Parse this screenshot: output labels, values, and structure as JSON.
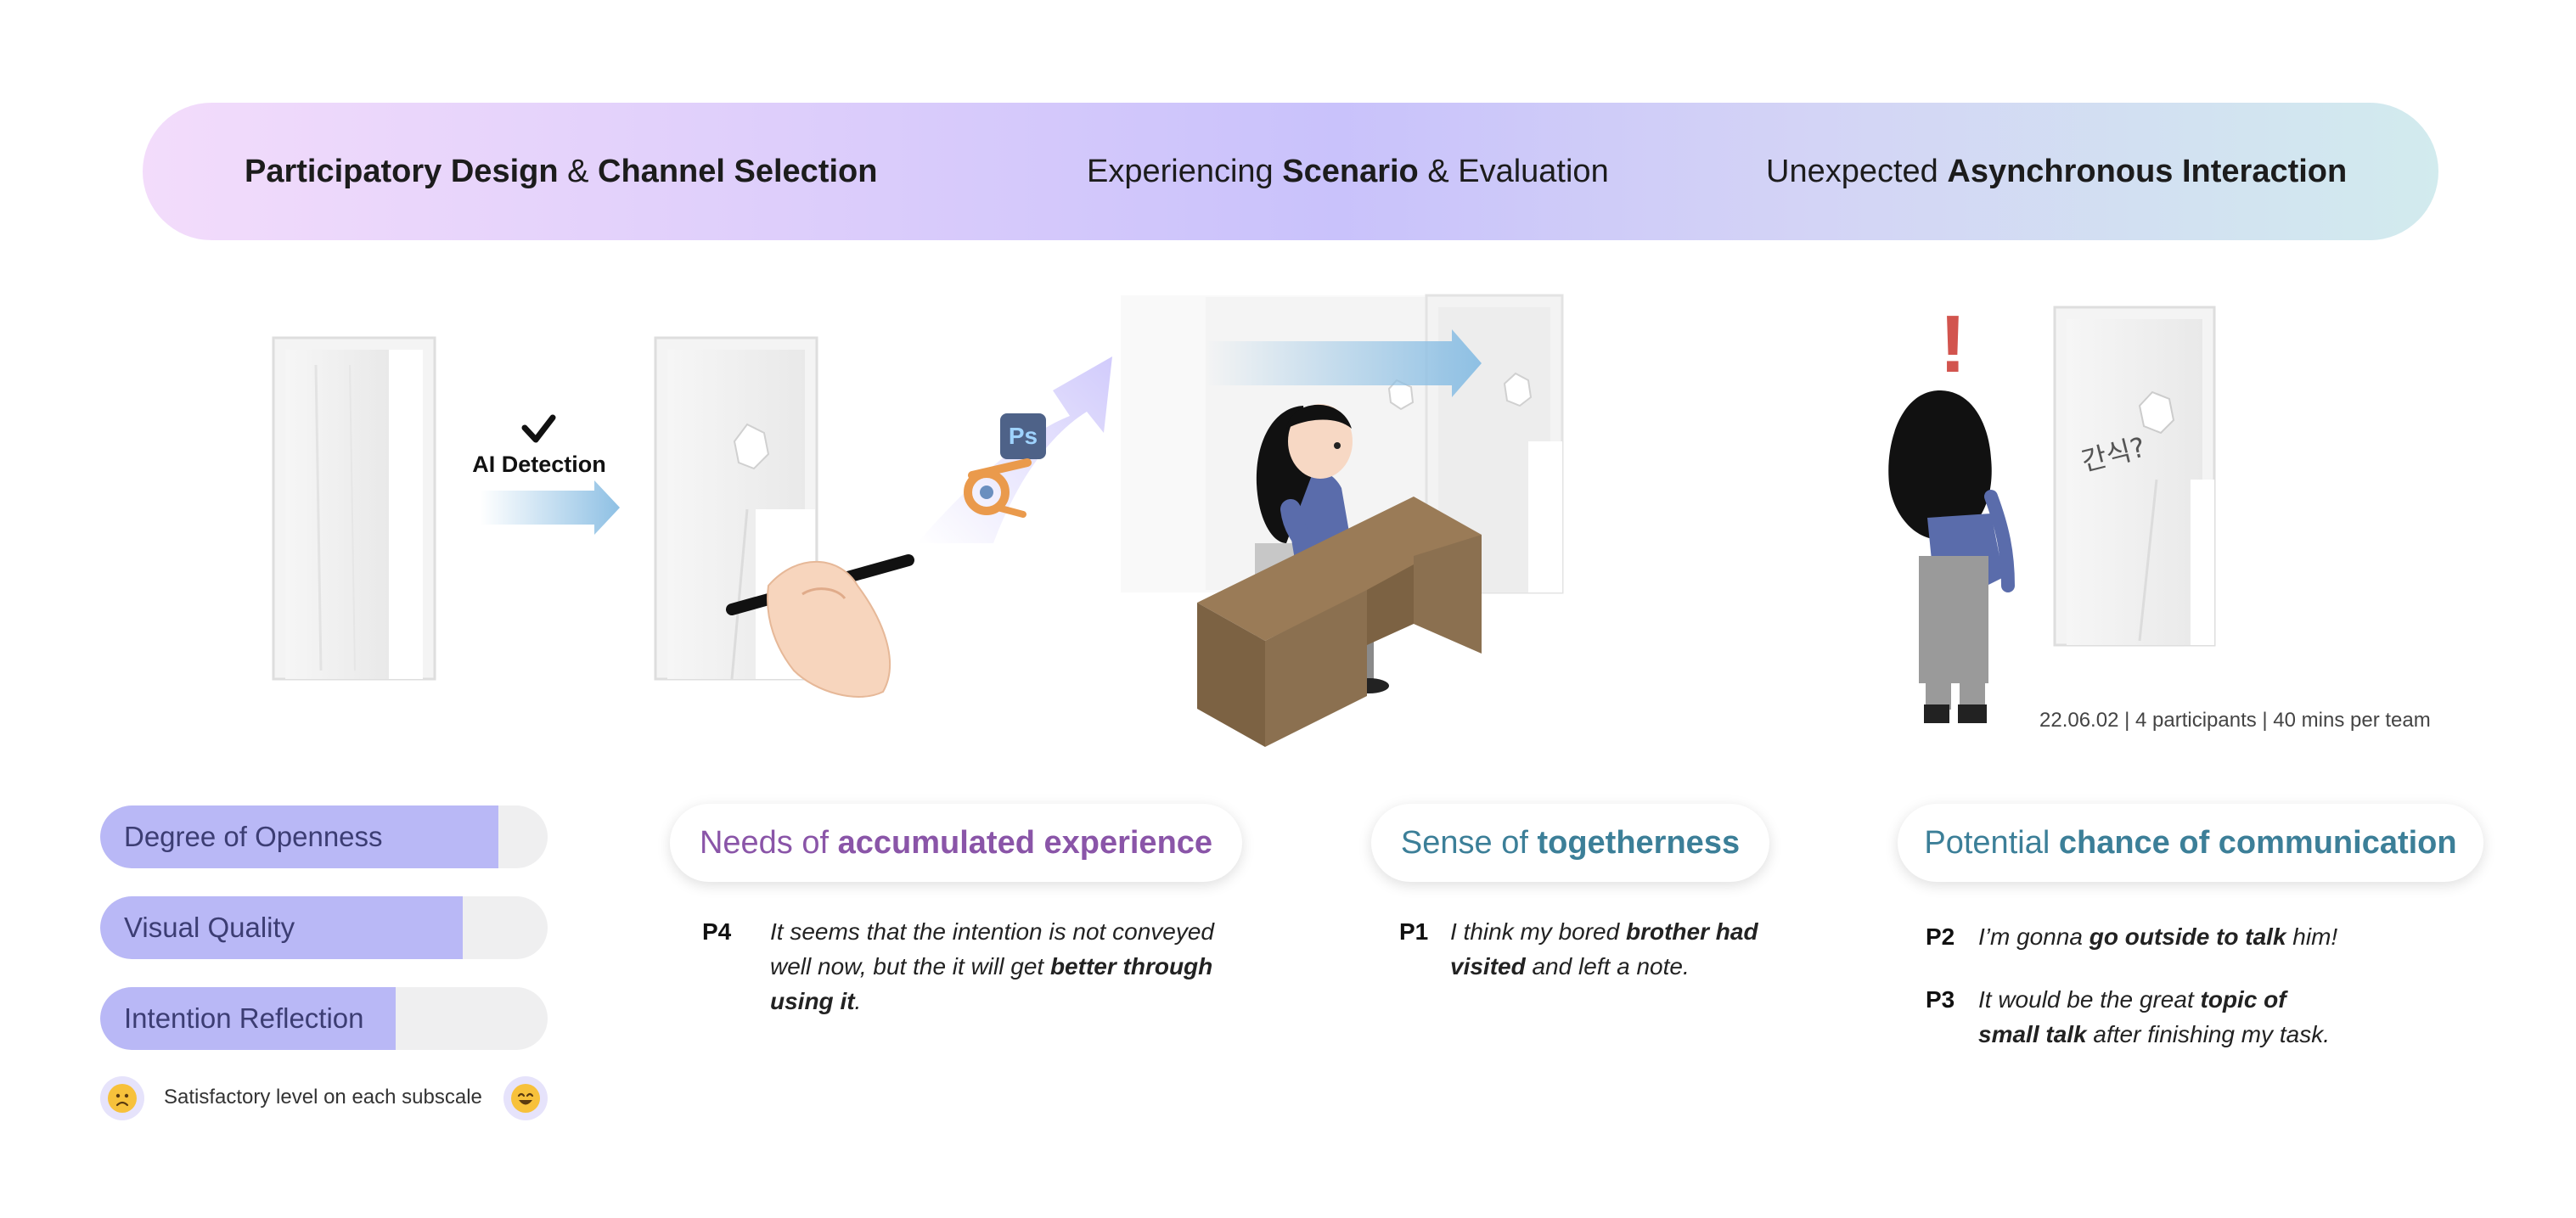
{
  "banner": {
    "stage1": {
      "bold1": "Participatory Design",
      "mid": " & ",
      "bold2": "Channel Selection"
    },
    "stage2": {
      "pre": "Experiencing ",
      "bold": "Scenario",
      "post": " & Evaluation"
    },
    "stage3": {
      "pre": "Unexpected ",
      "bold": "Asynchronous Interaction"
    }
  },
  "illustration": {
    "ai_detection_label": "AI Detection",
    "ps_label": "Ps",
    "korean_note": "간식?",
    "exclamation": "!",
    "session_info": "22.06.02 | 4 participants | 40 mins per team"
  },
  "subscales": {
    "items": [
      {
        "label": "Degree of Openness",
        "level": 0.89
      },
      {
        "label": "Visual Quality",
        "level": 0.81
      },
      {
        "label": "Intention Reflection",
        "level": 0.66
      }
    ],
    "caption": "Satisfactory level on each subscale"
  },
  "themes": {
    "accumulated": {
      "pre": "Needs of ",
      "bold": "accumulated experience",
      "quotes": [
        {
          "id": "P4",
          "parts": [
            "It seems that the intention is not conveyed well now, but the it will get ",
            "better through using it",
            "."
          ]
        }
      ]
    },
    "togetherness": {
      "pre": "Sense of ",
      "bold": "togetherness",
      "quotes": [
        {
          "id": "P1",
          "parts": [
            "I think my bored ",
            "brother had visited",
            " and left a note."
          ]
        }
      ]
    },
    "communication": {
      "pre": "Potential ",
      "bold": "chance of communication",
      "quotes": [
        {
          "id": "P2",
          "parts": [
            "I’m gonna ",
            "go outside to talk",
            " him!"
          ]
        },
        {
          "id": "P3",
          "parts": [
            "It would be the great ",
            "topic of small talk",
            " after finishing my task."
          ]
        }
      ]
    }
  },
  "colors": {
    "banner_pink": "#f3dcfb",
    "banner_violet": "#c9c2fb",
    "banner_teal": "#d2ebee",
    "bar_fill": "#b9b8f6",
    "theme_purple": "#8a55a8",
    "theme_teal": "#3c7f98",
    "arrow_blue": "#8ec0e4",
    "desk_brown": "#8b7050",
    "alert_red": "#d2544e"
  }
}
